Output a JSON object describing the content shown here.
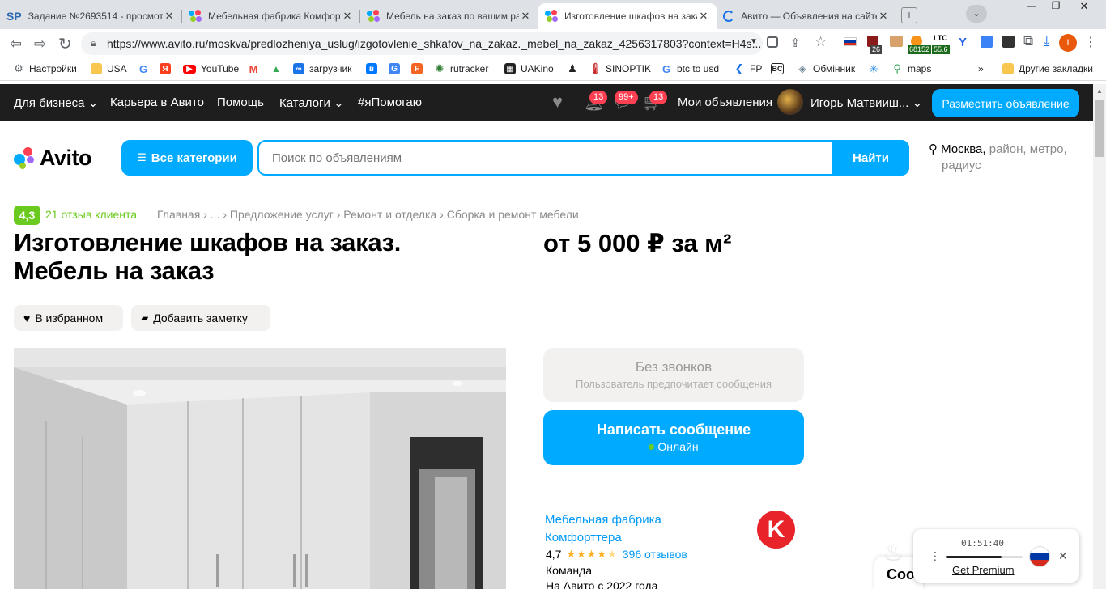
{
  "browser": {
    "tabs": [
      {
        "title": "Задание №2693514 - просмотр",
        "favicon": "SP"
      },
      {
        "title": "Мебельная фабрика Комфорт"
      },
      {
        "title": "Мебель на заказ по вашим ра"
      },
      {
        "title": "Изготовление шкафов на зака"
      },
      {
        "title": "Авито — Объявления на сайте"
      }
    ],
    "url": "https://www.avito.ru/moskva/predlozheniya_uslug/izgotovlenie_shkafov_na_zakaz._mebel_na_zakaz_4256317803?context=H4s...",
    "ext_badges": {
      "b1": "26",
      "b2": "68152",
      "ltc_label": "LTC",
      "ltc_value": "55.6",
      "profile": "I"
    },
    "bookmarks": [
      "Настройки",
      "USA",
      "",
      "",
      "YouTube",
      "",
      "",
      "загрузчик",
      "",
      "",
      "",
      "rutracker",
      "UAKino",
      "",
      "SINOPTIK",
      "btc to usd",
      "FP",
      "BC",
      "Обмінник",
      "",
      "maps"
    ],
    "other_bookmarks": "Другие закладки",
    "more": "»"
  },
  "topnav": {
    "business": "Для бизнеса",
    "career": "Карьера в Авито",
    "help": "Помощь",
    "catalogs": "Каталоги",
    "help_tag": "#яПомогаю",
    "notif_badge": "13",
    "msg_badge": "99+",
    "cart_badge": "13",
    "my_ads": "Мои объявления",
    "user": "Игорь Матвииш...",
    "post_button": "Разместить объявление"
  },
  "header": {
    "logo": "Avito",
    "categories_button": "Все категории",
    "search_placeholder": "Поиск по объявлениям",
    "search_button": "Найти",
    "location_city": "Москва,",
    "location_rest1": " район, метро,",
    "location_rest2": "радиус"
  },
  "listing": {
    "rating": "4,3",
    "reviews_link": "21 отзыв клиента",
    "breadcrumbs": [
      "Главная",
      "...",
      "Предложение услуг",
      "Ремонт и отделка",
      "Сборка и ремонт мебели"
    ],
    "crumb_sep": "›",
    "title_line1": "Изготовление шкафов на заказ.",
    "title_line2": "Мебель на заказ",
    "price": "от 5 000 ₽ за м²",
    "fav_button": "В избранном",
    "note_button": "Добавить заметку"
  },
  "contact": {
    "no_calls_title": "Без звонков",
    "no_calls_sub": "Пользователь предпочитает сообщения",
    "write_button": "Написать сообщение",
    "online": "Онлайн"
  },
  "seller": {
    "name_line1": "Мебельная фабрика",
    "name_line2": "Комфорттера",
    "rating": "4,7",
    "stars": 4.7,
    "reviews": "396 отзывов",
    "type": "Команда",
    "since": "На Авито с 2022 года"
  },
  "vpn_popup": {
    "timer": "01:51:40",
    "premium": "Get Premium",
    "progress": 0.72
  },
  "cookie_partial": "Coo",
  "colors": {
    "accent": "#00aaff",
    "dark": "#1e1e1e",
    "badge": "#ff4053",
    "green": "#6bca1f"
  }
}
